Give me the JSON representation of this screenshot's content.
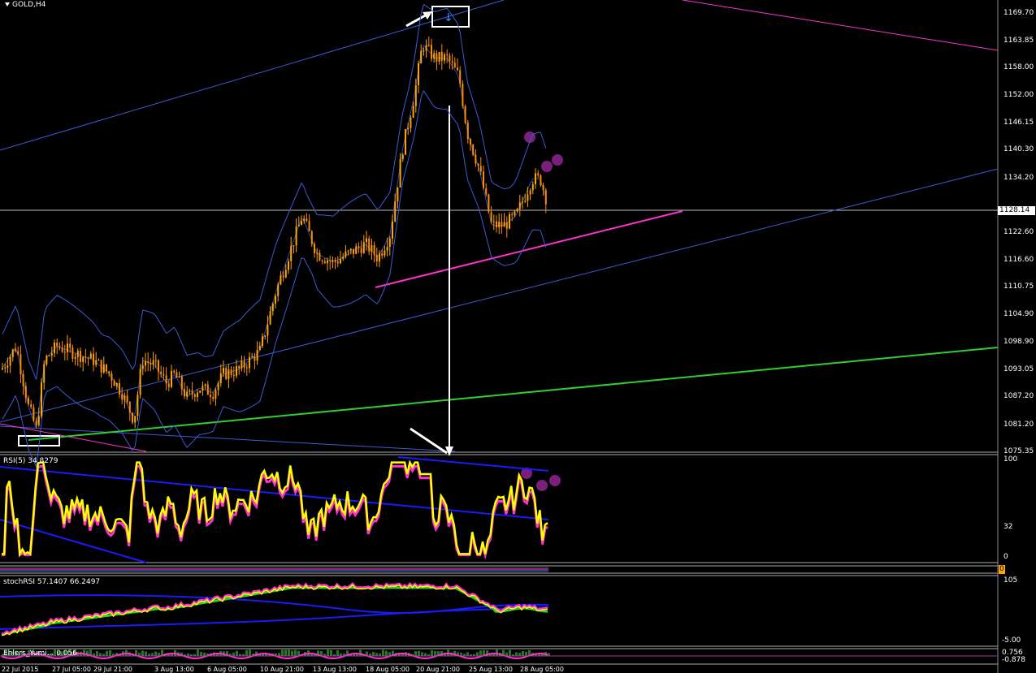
{
  "title": "GOLD,H4",
  "current_price": "1128.14",
  "price_axis": [
    "1169.70",
    "1163.85",
    "1158.00",
    "1152.00",
    "1146.15",
    "1140.30",
    "1134.20",
    "1122.60",
    "1116.60",
    "1110.75",
    "1104.90",
    "1098.90",
    "1093.05",
    "1087.20",
    "1081.20",
    "1075.35"
  ],
  "time_axis": [
    "22 Jul 2015",
    "27 Jul 05:00",
    "29 Jul 21:00",
    "3 Aug 13:00",
    "6 Aug 05:00",
    "10 Aug 21:00",
    "13 Aug 13:00",
    "18 Aug 05:00",
    "20 Aug 21:00",
    "25 Aug 13:00",
    "28 Aug 05:00"
  ],
  "rsi": {
    "label": "RSI(5) 34.8279",
    "levels": [
      "100",
      "32",
      "0"
    ]
  },
  "indicator2": {
    "level": "0"
  },
  "stochrsi": {
    "label": "stochRSI 57.1407 66.2497",
    "levels": [
      "105",
      "-5.00"
    ]
  },
  "indicator4": {
    "label": "Ehlers_Yumi... 0.056",
    "levels": [
      "0.756",
      "-0.878"
    ]
  },
  "colors": {
    "bull": "#ffa500",
    "bear": "#ff8c00",
    "bands": "#3b5bd6",
    "magenta": "#ff33cc",
    "green": "#33cc33",
    "rsi": "#ffff00"
  },
  "chart_data": [
    {
      "type": "line",
      "title": "GOLD,H4",
      "ylim": [
        1075.35,
        1172.5
      ],
      "x": [
        "22 Jul 2015",
        "27 Jul 05:00",
        "29 Jul 21:00",
        "3 Aug 13:00",
        "6 Aug 05:00",
        "10 Aug 21:00",
        "13 Aug 13:00",
        "18 Aug 05:00",
        "20 Aug 21:00",
        "25 Aug 13:00",
        "28 Aug 05:00"
      ],
      "series": [
        {
          "values": [
            1093,
            1092,
            1086,
            1092,
            1091,
            1125,
            1117,
            1125,
            1160,
            1120,
            1128.14
          ]
        }
      ]
    },
    {
      "type": "line",
      "title": "RSI(5) 34.8279",
      "ylim": [
        0,
        100
      ],
      "x": [
        "22 Jul 2015",
        "27 Jul 05:00",
        "29 Jul 21:00",
        "3 Aug 13:00",
        "6 Aug 05:00",
        "10 Aug 21:00",
        "13 Aug 13:00",
        "18 Aug 05:00",
        "20 Aug 21:00",
        "25 Aug 13:00",
        "28 Aug 05:00"
      ],
      "series": [
        {
          "values": [
            55,
            60,
            45,
            65,
            40,
            80,
            60,
            55,
            95,
            20,
            34.8279
          ]
        }
      ]
    },
    {
      "type": "line",
      "title": "stochRSI 57.1407 66.2497",
      "ylim": [
        -5,
        105
      ],
      "series": [
        {
          "values": [
            10,
            40,
            60,
            95,
            97,
            98,
            70,
            57.1407
          ]
        },
        {
          "values": [
            15,
            35,
            55,
            85,
            95,
            95,
            75,
            66.2497
          ]
        }
      ]
    }
  ]
}
